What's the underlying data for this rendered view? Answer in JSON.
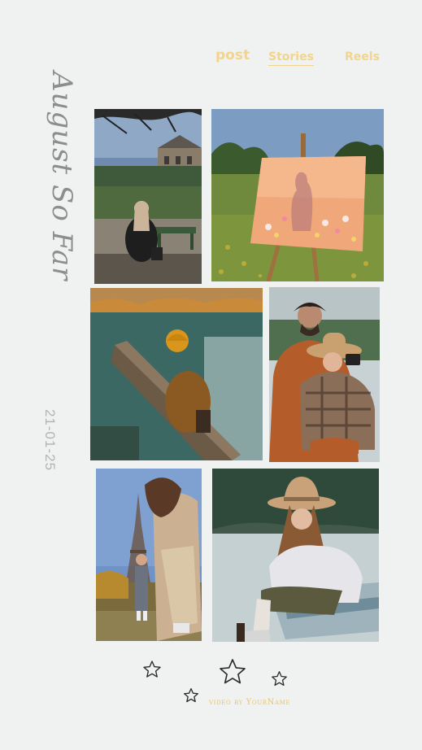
{
  "tabs": [
    {
      "id": "post",
      "label": "post",
      "active": false
    },
    {
      "id": "stories",
      "label": "Stories",
      "active": true
    },
    {
      "id": "reels",
      "label": "Reels",
      "active": false
    }
  ],
  "title": "August So Far",
  "date": "21-01-25",
  "photos": [
    {
      "name": "photo-paris-bench",
      "icon": "paris-bench-photo"
    },
    {
      "name": "photo-easel-painting",
      "icon": "easel-painting-photo"
    },
    {
      "name": "photo-lake-log",
      "icon": "lake-log-photo"
    },
    {
      "name": "photo-couple-camera",
      "icon": "couple-camera-photo"
    },
    {
      "name": "photo-eiffel-girl",
      "icon": "eiffel-tower-photo"
    },
    {
      "name": "photo-boat-girl",
      "icon": "boat-photo"
    }
  ],
  "credit": "video by YourName",
  "colors": {
    "accent": "#f2d48a",
    "background": "#f0f2f1",
    "title": "#8d8d8d",
    "date": "#b3b3b3"
  }
}
